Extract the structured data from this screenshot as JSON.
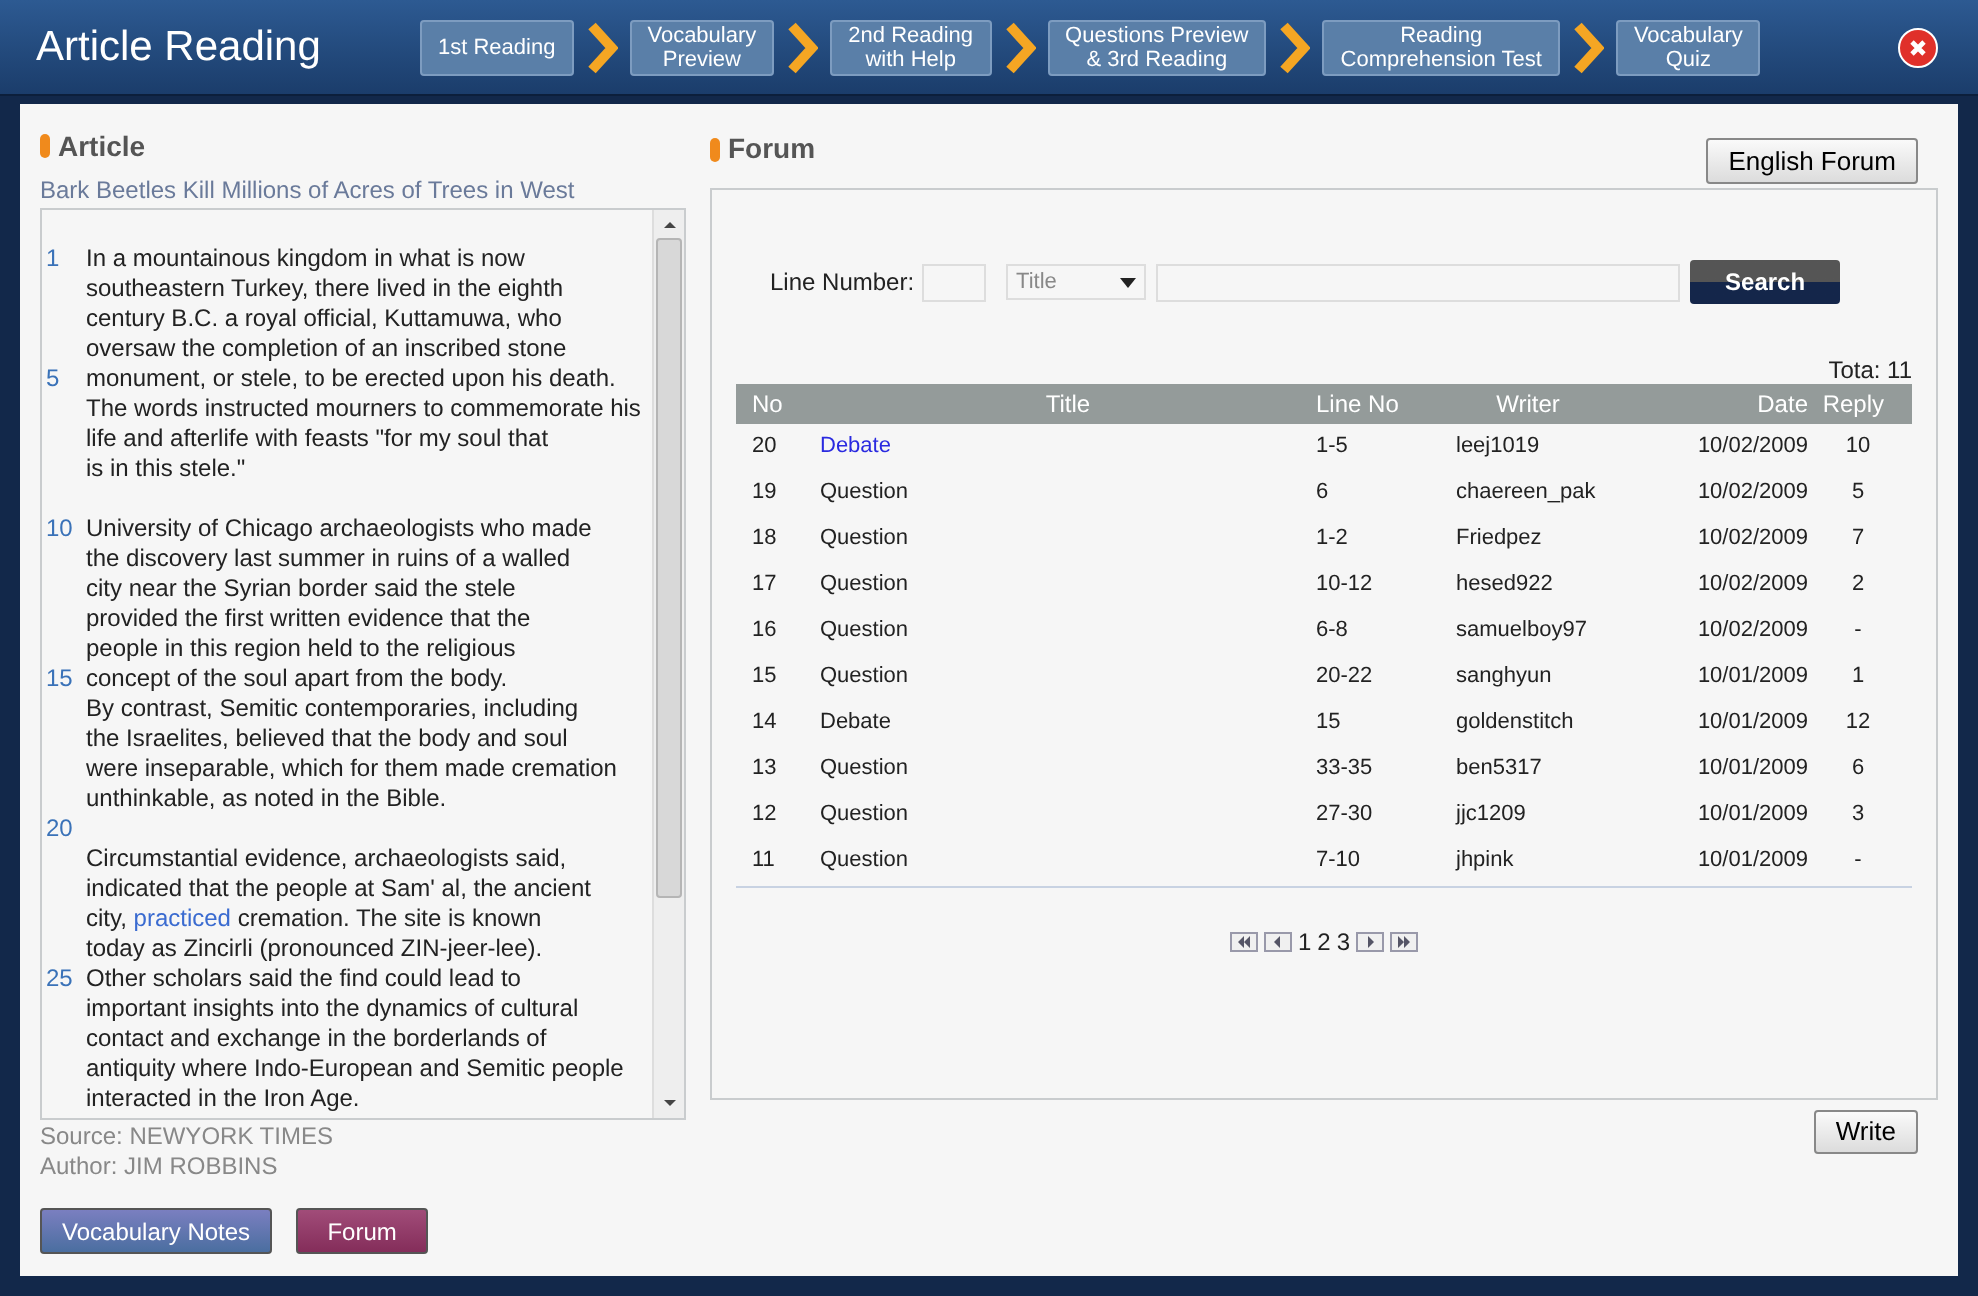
{
  "window": {
    "title": "Article Reading"
  },
  "steps": [
    "1st Reading",
    "Vocabulary\nPreview",
    "2nd Reading\nwith Help",
    "Questions Preview\n& 3rd Reading",
    "Reading\nComprehension Test",
    "Vocabulary\nQuiz"
  ],
  "article": {
    "heading": "Article",
    "title": "Bark Beetles Kill Millions of Acres of Trees in West",
    "paragraphs": [
      {
        "lines": [
          {
            "number": "1",
            "text": "In a mountainous kingdom in what is now"
          },
          {
            "text": "southeastern Turkey, there lived in the eighth"
          },
          {
            "text": "century B.C. a royal official, Kuttamuwa, who"
          },
          {
            "text": "oversaw the completion of an inscribed stone"
          },
          {
            "number": "5",
            "text": "monument, or stele, to be erected upon his death."
          },
          {
            "text": "The words instructed mourners to commemorate his"
          },
          {
            "text": "life and afterlife with feasts \"for my soul that"
          },
          {
            "text": "is in this stele.\""
          }
        ]
      },
      {
        "lines": [
          {
            "number": "10",
            "text": "University of Chicago archaeologists who made"
          },
          {
            "text": "the discovery last summer in ruins of a walled"
          },
          {
            "text": "city near the Syrian border said the stele"
          },
          {
            "text": "provided the first written evidence that the"
          },
          {
            "text": "people in this region held to the religious"
          },
          {
            "number": "15",
            "text": "concept of the soul apart from the body."
          },
          {
            "text": "By contrast, Semitic contemporaries, including"
          },
          {
            "text": "the Israelites, believed that the body and soul"
          },
          {
            "text": "were inseparable, which for them made cremation"
          },
          {
            "text": "unthinkable, as noted in the Bible."
          },
          {
            "number": "20"
          },
          {
            "text": "Circumstantial evidence, archaeologists said,"
          },
          {
            "text": "indicated that the people at Sam' al, the ancient"
          },
          {
            "parts": [
              {
                "text": "city, "
              },
              {
                "text": "practiced",
                "kind": "link"
              },
              {
                "text": " cremation. The site is known"
              }
            ]
          },
          {
            "text": "today as Zincirli (pronounced ZIN-jeer-lee)."
          },
          {
            "number": "25",
            "text": "Other scholars said the find could lead to"
          },
          {
            "text": "important insights into the dynamics of cultural"
          },
          {
            "text": "contact and exchange in the borderlands of"
          },
          {
            "text": "antiquity where Indo-European and Semitic people"
          },
          {
            "text": "interacted in the Iron Age."
          }
        ]
      }
    ],
    "source": "Source: NEWYORK TIMES",
    "author": "Author: JIM ROBBINS",
    "buttons": [
      {
        "label": "Vocabulary Notes",
        "kind": "notes"
      },
      {
        "label": "Forum",
        "kind": "forum"
      }
    ]
  },
  "forum": {
    "heading": "Forum",
    "english_button": "English Forum",
    "search": {
      "line_label": "Line Number:",
      "field_select": "Title",
      "button": "Search"
    },
    "total": "Tota: 11",
    "columns": [
      "No",
      "Title",
      "Line No",
      "Writer",
      "Date",
      "Reply"
    ],
    "rows": [
      {
        "no": "20",
        "title": "Debate",
        "line": "1-5",
        "writer": "leej1019",
        "date": "10/02/2009",
        "reply": "10",
        "selected": true
      },
      {
        "no": "19",
        "title": "Question",
        "line": "6",
        "writer": "chaereen_pak",
        "date": "10/02/2009",
        "reply": "5",
        "selected": false
      },
      {
        "no": "18",
        "title": "Question",
        "line": "1-2",
        "writer": "Friedpez",
        "date": "10/02/2009",
        "reply": "7",
        "selected": false
      },
      {
        "no": "17",
        "title": "Question",
        "line": "10-12",
        "writer": "hesed922",
        "date": "10/02/2009",
        "reply": "2",
        "selected": false
      },
      {
        "no": "16",
        "title": "Question",
        "line": "6-8",
        "writer": "samuelboy97",
        "date": "10/02/2009",
        "reply": "-",
        "selected": false
      },
      {
        "no": "15",
        "title": "Question",
        "line": "20-22",
        "writer": "sanghyun",
        "date": "10/01/2009",
        "reply": "1",
        "selected": false
      },
      {
        "no": "14",
        "title": "Debate",
        "line": "15",
        "writer": "goldenstitch",
        "date": "10/01/2009",
        "reply": "12",
        "selected": false
      },
      {
        "no": "13",
        "title": "Question",
        "line": "33-35",
        "writer": "ben5317",
        "date": "10/01/2009",
        "reply": "6",
        "selected": false
      },
      {
        "no": "12",
        "title": "Question",
        "line": "27-30",
        "writer": "jjc1209",
        "date": "10/01/2009",
        "reply": "3",
        "selected": false
      },
      {
        "no": "11",
        "title": "Question",
        "line": "7-10",
        "writer": "jhpink",
        "date": "10/01/2009",
        "reply": "-",
        "selected": false
      }
    ],
    "pages": [
      "1",
      "2",
      "3"
    ],
    "write_button": "Write"
  }
}
